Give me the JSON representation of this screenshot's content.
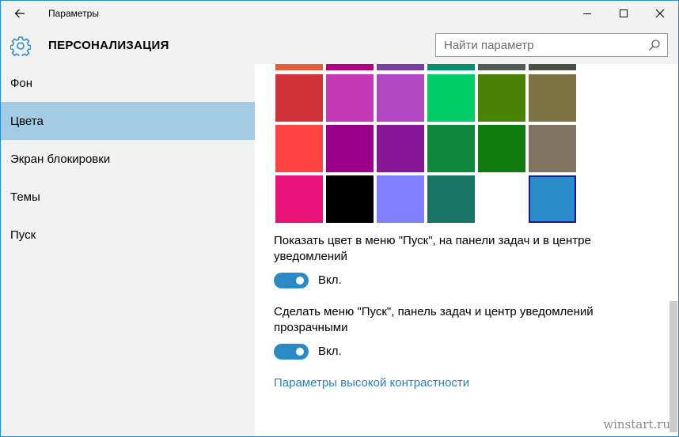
{
  "window": {
    "title": "Параметры",
    "back_icon": "arrow-left-icon",
    "minimize_icon": "minimize-icon",
    "maximize_icon": "maximize-icon",
    "close_icon": "close-icon"
  },
  "header": {
    "icon": "gear-icon",
    "title": "ПЕРСОНАЛИЗАЦИЯ",
    "search": {
      "placeholder": "Найти параметр",
      "value": "",
      "icon": "search-icon"
    }
  },
  "sidebar": {
    "items": [
      {
        "label": "Фон",
        "active": false
      },
      {
        "label": "Цвета",
        "active": true
      },
      {
        "label": "Экран блокировки",
        "active": false
      },
      {
        "label": "Темы",
        "active": false
      },
      {
        "label": "Пуск",
        "active": false
      }
    ]
  },
  "colors": {
    "rows": [
      [
        "#e0603a",
        "#b20083",
        "#7a3fa4",
        "#008f6c",
        "#505a57",
        "#4a5047"
      ],
      [
        "#d13438",
        "#c239b3",
        "#b146c2",
        "#00cc6a",
        "#498205",
        "#7e7342"
      ],
      [
        "#ff4343",
        "#9a0089",
        "#881798",
        "#10893e",
        "#107c10",
        "#7e735f"
      ],
      [
        "#ea1179",
        "#000000",
        "#8080ff",
        "#177563",
        "",
        "#2b8ccc"
      ]
    ],
    "selected": "#2b8ccc",
    "selection_border": "#1a1a8a"
  },
  "settings": {
    "show_color": {
      "description": "Показать цвет в меню \"Пуск\", на панели задач и в центре уведомлений",
      "state_label": "Вкл.",
      "on": true
    },
    "transparency": {
      "description": "Сделать меню \"Пуск\", панель задач и центр уведомлений прозрачными",
      "state_label": "Вкл.",
      "on": true
    },
    "high_contrast_link": "Параметры высокой контрастности"
  },
  "theme": {
    "accent": "#2a8ac6",
    "sidebar_active": "#a3cbe3",
    "link": "#2a7fb8"
  },
  "watermark": "winstart.ru"
}
